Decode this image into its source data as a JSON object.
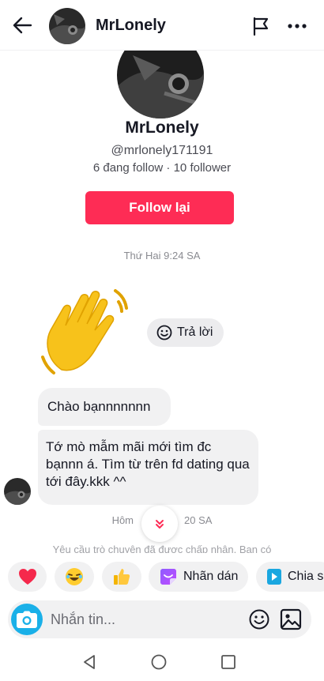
{
  "header": {
    "title": "MrLonely",
    "icons": {
      "back": "arrow-left",
      "report": "flag",
      "more": "three-dots"
    }
  },
  "profile": {
    "name": "MrLonely",
    "handle": "@mrlonely171191",
    "stats": "6 đang follow · 10 follower",
    "follow_label": "Follow lại"
  },
  "messages": {
    "timestamp_1": "Thứ Hai 9:24 SA",
    "sticker": "waving-hand",
    "reply_label": "Trả lời",
    "bubble_1": "Chào bạnnnnnnn",
    "bubble_2": "Tớ mò mẫm mãi mới tìm đc bạnnn á. Tìm từ trên fd dating qua tới đây.kkk ^^",
    "timestamp_2_left": "Hôm",
    "timestamp_2_right": "20 SA",
    "notice": "Yêu cầu trò chuyện đã được chấp nhận. Bạn có"
  },
  "quick_replies": {
    "sticker_label": "Nhãn dán",
    "share_label": "Chia s"
  },
  "composer": {
    "placeholder": "Nhắn tin..."
  },
  "colors": {
    "accent": "#fe2c55",
    "camera": "#1ab0e8",
    "bubble": "#f1f1f2"
  }
}
